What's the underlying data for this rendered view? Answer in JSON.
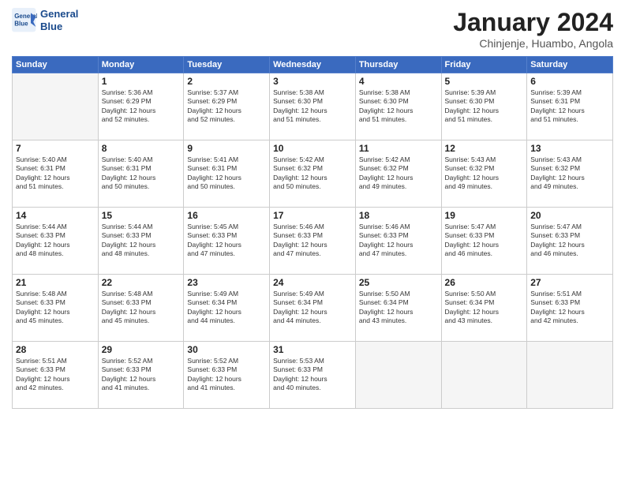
{
  "logo": {
    "line1": "General",
    "line2": "Blue"
  },
  "title": "January 2024",
  "subtitle": "Chinjenje, Huambo, Angola",
  "headers": [
    "Sunday",
    "Monday",
    "Tuesday",
    "Wednesday",
    "Thursday",
    "Friday",
    "Saturday"
  ],
  "weeks": [
    [
      {
        "day": "",
        "info": ""
      },
      {
        "day": "1",
        "info": "Sunrise: 5:36 AM\nSunset: 6:29 PM\nDaylight: 12 hours\nand 52 minutes."
      },
      {
        "day": "2",
        "info": "Sunrise: 5:37 AM\nSunset: 6:29 PM\nDaylight: 12 hours\nand 52 minutes."
      },
      {
        "day": "3",
        "info": "Sunrise: 5:38 AM\nSunset: 6:30 PM\nDaylight: 12 hours\nand 51 minutes."
      },
      {
        "day": "4",
        "info": "Sunrise: 5:38 AM\nSunset: 6:30 PM\nDaylight: 12 hours\nand 51 minutes."
      },
      {
        "day": "5",
        "info": "Sunrise: 5:39 AM\nSunset: 6:30 PM\nDaylight: 12 hours\nand 51 minutes."
      },
      {
        "day": "6",
        "info": "Sunrise: 5:39 AM\nSunset: 6:31 PM\nDaylight: 12 hours\nand 51 minutes."
      }
    ],
    [
      {
        "day": "7",
        "info": "Sunrise: 5:40 AM\nSunset: 6:31 PM\nDaylight: 12 hours\nand 51 minutes."
      },
      {
        "day": "8",
        "info": "Sunrise: 5:40 AM\nSunset: 6:31 PM\nDaylight: 12 hours\nand 50 minutes."
      },
      {
        "day": "9",
        "info": "Sunrise: 5:41 AM\nSunset: 6:31 PM\nDaylight: 12 hours\nand 50 minutes."
      },
      {
        "day": "10",
        "info": "Sunrise: 5:42 AM\nSunset: 6:32 PM\nDaylight: 12 hours\nand 50 minutes."
      },
      {
        "day": "11",
        "info": "Sunrise: 5:42 AM\nSunset: 6:32 PM\nDaylight: 12 hours\nand 49 minutes."
      },
      {
        "day": "12",
        "info": "Sunrise: 5:43 AM\nSunset: 6:32 PM\nDaylight: 12 hours\nand 49 minutes."
      },
      {
        "day": "13",
        "info": "Sunrise: 5:43 AM\nSunset: 6:32 PM\nDaylight: 12 hours\nand 49 minutes."
      }
    ],
    [
      {
        "day": "14",
        "info": "Sunrise: 5:44 AM\nSunset: 6:33 PM\nDaylight: 12 hours\nand 48 minutes."
      },
      {
        "day": "15",
        "info": "Sunrise: 5:44 AM\nSunset: 6:33 PM\nDaylight: 12 hours\nand 48 minutes."
      },
      {
        "day": "16",
        "info": "Sunrise: 5:45 AM\nSunset: 6:33 PM\nDaylight: 12 hours\nand 47 minutes."
      },
      {
        "day": "17",
        "info": "Sunrise: 5:46 AM\nSunset: 6:33 PM\nDaylight: 12 hours\nand 47 minutes."
      },
      {
        "day": "18",
        "info": "Sunrise: 5:46 AM\nSunset: 6:33 PM\nDaylight: 12 hours\nand 47 minutes."
      },
      {
        "day": "19",
        "info": "Sunrise: 5:47 AM\nSunset: 6:33 PM\nDaylight: 12 hours\nand 46 minutes."
      },
      {
        "day": "20",
        "info": "Sunrise: 5:47 AM\nSunset: 6:33 PM\nDaylight: 12 hours\nand 46 minutes."
      }
    ],
    [
      {
        "day": "21",
        "info": "Sunrise: 5:48 AM\nSunset: 6:33 PM\nDaylight: 12 hours\nand 45 minutes."
      },
      {
        "day": "22",
        "info": "Sunrise: 5:48 AM\nSunset: 6:33 PM\nDaylight: 12 hours\nand 45 minutes."
      },
      {
        "day": "23",
        "info": "Sunrise: 5:49 AM\nSunset: 6:34 PM\nDaylight: 12 hours\nand 44 minutes."
      },
      {
        "day": "24",
        "info": "Sunrise: 5:49 AM\nSunset: 6:34 PM\nDaylight: 12 hours\nand 44 minutes."
      },
      {
        "day": "25",
        "info": "Sunrise: 5:50 AM\nSunset: 6:34 PM\nDaylight: 12 hours\nand 43 minutes."
      },
      {
        "day": "26",
        "info": "Sunrise: 5:50 AM\nSunset: 6:34 PM\nDaylight: 12 hours\nand 43 minutes."
      },
      {
        "day": "27",
        "info": "Sunrise: 5:51 AM\nSunset: 6:33 PM\nDaylight: 12 hours\nand 42 minutes."
      }
    ],
    [
      {
        "day": "28",
        "info": "Sunrise: 5:51 AM\nSunset: 6:33 PM\nDaylight: 12 hours\nand 42 minutes."
      },
      {
        "day": "29",
        "info": "Sunrise: 5:52 AM\nSunset: 6:33 PM\nDaylight: 12 hours\nand 41 minutes."
      },
      {
        "day": "30",
        "info": "Sunrise: 5:52 AM\nSunset: 6:33 PM\nDaylight: 12 hours\nand 41 minutes."
      },
      {
        "day": "31",
        "info": "Sunrise: 5:53 AM\nSunset: 6:33 PM\nDaylight: 12 hours\nand 40 minutes."
      },
      {
        "day": "",
        "info": ""
      },
      {
        "day": "",
        "info": ""
      },
      {
        "day": "",
        "info": ""
      }
    ]
  ]
}
